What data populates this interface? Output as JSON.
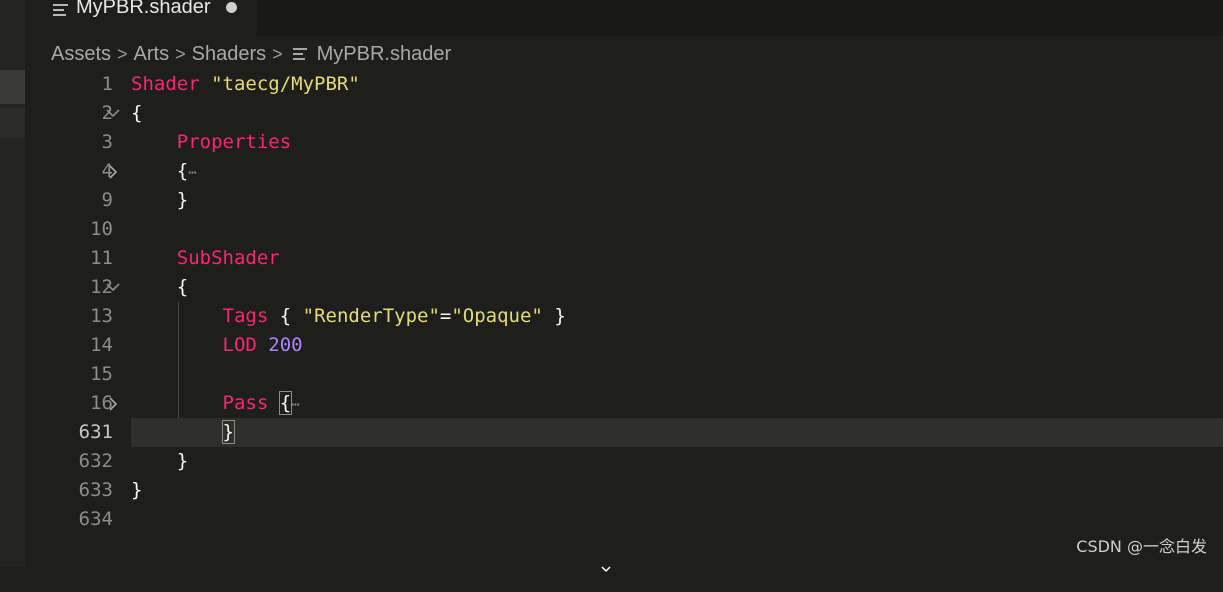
{
  "tab": {
    "title": "MyPBR.shader",
    "dirty": true
  },
  "breadcrumb": {
    "items": [
      "Assets",
      "Arts",
      "Shaders"
    ],
    "file": "MyPBR.shader"
  },
  "editor": {
    "lines": [
      {
        "n": "1",
        "fold": null
      },
      {
        "n": "2",
        "fold": "expanded"
      },
      {
        "n": "3",
        "fold": null
      },
      {
        "n": "4",
        "fold": "collapsed"
      },
      {
        "n": "9",
        "fold": null
      },
      {
        "n": "10",
        "fold": null
      },
      {
        "n": "11",
        "fold": null
      },
      {
        "n": "12",
        "fold": "expanded"
      },
      {
        "n": "13",
        "fold": null
      },
      {
        "n": "14",
        "fold": null
      },
      {
        "n": "15",
        "fold": null
      },
      {
        "n": "16",
        "fold": "collapsed"
      },
      {
        "n": "631",
        "fold": null,
        "current": true
      },
      {
        "n": "632",
        "fold": null
      },
      {
        "n": "633",
        "fold": null
      },
      {
        "n": "634",
        "fold": null
      }
    ],
    "code": {
      "shader_kw": "Shader",
      "shader_name": "\"taecg/MyPBR\"",
      "open_brace": "{",
      "close_brace": "}",
      "properties_kw": "Properties",
      "ellipsis": "⋯",
      "subshader_kw": "SubShader",
      "tags_kw": "Tags",
      "tags_open": "{ ",
      "tags_key": "\"RenderType\"",
      "tags_eq": "=",
      "tags_val": "\"Opaque\"",
      "tags_close": " }",
      "lod_kw": "LOD",
      "lod_val": "200",
      "pass_kw": "Pass"
    }
  },
  "watermark": "CSDN @一念白发",
  "colors": {
    "keyword": "#f92672",
    "string": "#e6db74",
    "number": "#ae81ff",
    "background": "#1e1f1c"
  }
}
